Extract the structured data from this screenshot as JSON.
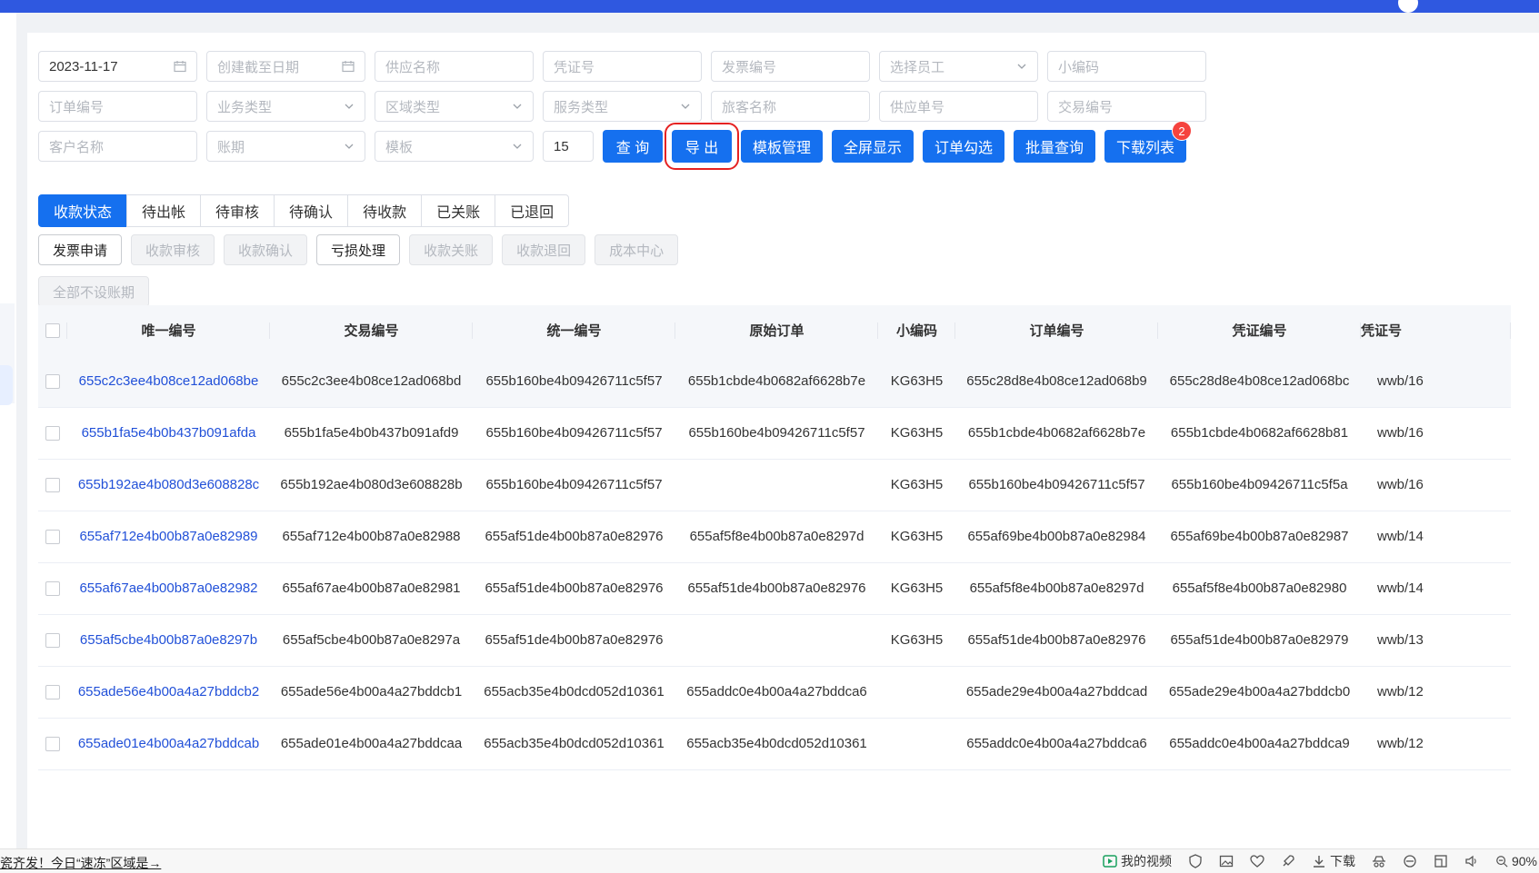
{
  "filters": {
    "row1": [
      {
        "name": "created-from-date-field",
        "value": "2023-11-17",
        "placeholder": "",
        "suffix": "calendar-icon"
      },
      {
        "name": "created-to-date-field",
        "value": "",
        "placeholder": "创建截至日期",
        "suffix": "calendar-icon"
      },
      {
        "name": "supplier-name-input",
        "value": "",
        "placeholder": "供应名称",
        "suffix": ""
      },
      {
        "name": "voucher-no-input",
        "value": "",
        "placeholder": "凭证号",
        "suffix": ""
      },
      {
        "name": "invoice-no-input",
        "value": "",
        "placeholder": "发票编号",
        "suffix": ""
      },
      {
        "name": "employee-select",
        "value": "",
        "placeholder": "选择员工",
        "suffix": "chevron-down-icon"
      },
      {
        "name": "short-code-input",
        "value": "",
        "placeholder": "小编码",
        "suffix": ""
      }
    ],
    "row2": [
      {
        "name": "order-no-input",
        "value": "",
        "placeholder": "订单编号",
        "suffix": ""
      },
      {
        "name": "business-type-select",
        "value": "",
        "placeholder": "业务类型",
        "suffix": "chevron-down-icon"
      },
      {
        "name": "region-type-select",
        "value": "",
        "placeholder": "区域类型",
        "suffix": "chevron-down-icon"
      },
      {
        "name": "service-type-select",
        "value": "",
        "placeholder": "服务类型",
        "suffix": "chevron-down-icon"
      },
      {
        "name": "traveler-name-input",
        "value": "",
        "placeholder": "旅客名称",
        "suffix": ""
      },
      {
        "name": "supply-order-no-input",
        "value": "",
        "placeholder": "供应单号",
        "suffix": ""
      },
      {
        "name": "transaction-no-input",
        "value": "",
        "placeholder": "交易编号",
        "suffix": ""
      }
    ],
    "row3": [
      {
        "name": "customer-name-input",
        "value": "",
        "placeholder": "客户名称",
        "suffix": ""
      },
      {
        "name": "account-period-select",
        "value": "",
        "placeholder": "账期",
        "suffix": "chevron-down-icon"
      },
      {
        "name": "template-select",
        "value": "",
        "placeholder": "模板",
        "suffix": "chevron-down-icon"
      }
    ],
    "page_size": "15"
  },
  "toolbar": {
    "query_label": "查 询",
    "export_label": "导 出",
    "template_mgmt_label": "模板管理",
    "fullscreen_label": "全屏显示",
    "order_select_label": "订单勾选",
    "batch_query_label": "批量查询",
    "download_list_label": "下载列表",
    "download_badge": "2"
  },
  "status_tabs": [
    "收款状态",
    "待出帐",
    "待审核",
    "待确认",
    "待收款",
    "已关账",
    "已退回"
  ],
  "actions": [
    {
      "label": "发票申请",
      "enabled": true
    },
    {
      "label": "收款审核",
      "enabled": false
    },
    {
      "label": "收款确认",
      "enabled": false
    },
    {
      "label": "亏损处理",
      "enabled": true
    },
    {
      "label": "收款关账",
      "enabled": false
    },
    {
      "label": "收款退回",
      "enabled": false
    },
    {
      "label": "成本中心",
      "enabled": false
    }
  ],
  "actions_row2": {
    "label": "全部不设账期",
    "enabled": false
  },
  "table": {
    "columns": [
      "唯一编号",
      "交易编号",
      "统一编号",
      "原始订单",
      "小编码",
      "订单编号",
      "凭证编号",
      "凭证号"
    ],
    "rows": [
      [
        "655c2c3ee4b08ce12ad068be",
        "655c2c3ee4b08ce12ad068bd",
        "655b160be4b09426711c5f57",
        "655b1cbde4b0682af6628b7e",
        "KG63H5",
        "655c28d8e4b08ce12ad068b9",
        "655c28d8e4b08ce12ad068bc",
        "wwb/16"
      ],
      [
        "655b1fa5e4b0b437b091afda",
        "655b1fa5e4b0b437b091afd9",
        "655b160be4b09426711c5f57",
        "655b160be4b09426711c5f57",
        "KG63H5",
        "655b1cbde4b0682af6628b7e",
        "655b1cbde4b0682af6628b81",
        "wwb/16"
      ],
      [
        "655b192ae4b080d3e608828c",
        "655b192ae4b080d3e608828b",
        "655b160be4b09426711c5f57",
        "",
        "KG63H5",
        "655b160be4b09426711c5f57",
        "655b160be4b09426711c5f5a",
        "wwb/16"
      ],
      [
        "655af712e4b00b87a0e82989",
        "655af712e4b00b87a0e82988",
        "655af51de4b00b87a0e82976",
        "655af5f8e4b00b87a0e8297d",
        "KG63H5",
        "655af69be4b00b87a0e82984",
        "655af69be4b00b87a0e82987",
        "wwb/14"
      ],
      [
        "655af67ae4b00b87a0e82982",
        "655af67ae4b00b87a0e82981",
        "655af51de4b00b87a0e82976",
        "655af51de4b00b87a0e82976",
        "KG63H5",
        "655af5f8e4b00b87a0e8297d",
        "655af5f8e4b00b87a0e82980",
        "wwb/14"
      ],
      [
        "655af5cbe4b00b87a0e8297b",
        "655af5cbe4b00b87a0e8297a",
        "655af51de4b00b87a0e82976",
        "",
        "KG63H5",
        "655af51de4b00b87a0e82976",
        "655af51de4b00b87a0e82979",
        "wwb/13"
      ],
      [
        "655ade56e4b00a4a27bddcb2",
        "655ade56e4b00a4a27bddcb1",
        "655acb35e4b0dcd052d10361",
        "655addc0e4b00a4a27bddca6",
        "",
        "655ade29e4b00a4a27bddcad",
        "655ade29e4b00a4a27bddcb0",
        "wwb/12"
      ],
      [
        "655ade01e4b00a4a27bddcab",
        "655ade01e4b00a4a27bddcaa",
        "655acb35e4b0dcd052d10361",
        "655acb35e4b0dcd052d10361",
        "",
        "655addc0e4b00a4a27bddca6",
        "655addc0e4b00a4a27bddca9",
        "wwb/12"
      ]
    ]
  },
  "statusbar": {
    "ticker": "瓷齐发！今日“速冻”区域是→",
    "my_video": "我的视频",
    "download": "下载",
    "zoom": "90%"
  },
  "colors": {
    "primary": "#1570ef",
    "topbar": "#2f58e0",
    "link": "#2150d8",
    "highlight": "#e52222",
    "badge": "#f5433e"
  }
}
